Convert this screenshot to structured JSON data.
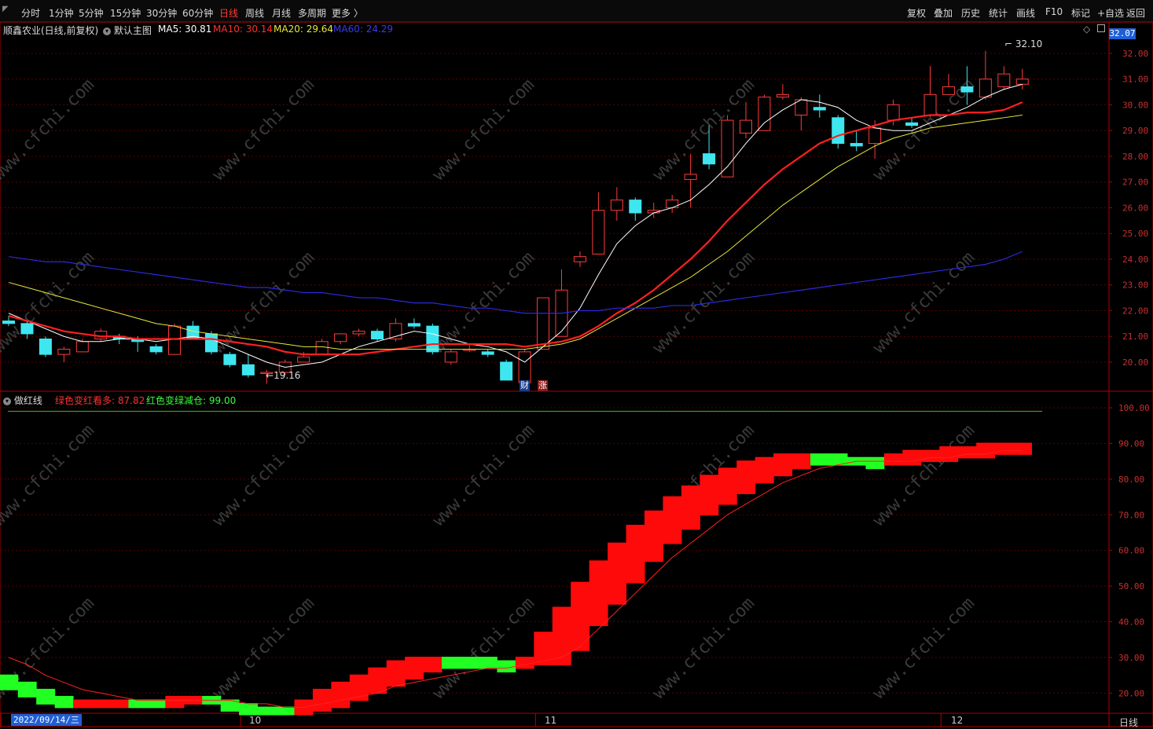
{
  "toolbar": {
    "left": [
      "分时",
      "1分钟",
      "5分钟",
      "15分钟",
      "30分钟",
      "60分钟",
      "日线",
      "周线",
      "月线",
      "多周期",
      "更多 〉"
    ],
    "active": "日线",
    "right": [
      "复权",
      "叠加",
      "历史",
      "统计",
      "画线",
      "F10",
      "标记",
      "+自选",
      "返回"
    ]
  },
  "header": {
    "stock": "顺鑫农业(日线,前复权)",
    "main_label": "默认主图",
    "ma5": "MA5: 30.81",
    "ma10": "MA10: 30.14",
    "ma20": "MA20: 29.64",
    "ma60": "MA60: 24.29",
    "current_price_tag": "32.07"
  },
  "indicator_header": {
    "name": "做红线",
    "green_to_red": "绿色变红看多: 87.82",
    "red_to_green": "红色变绿减仓: 99.00"
  },
  "annotations": {
    "high": "32.10",
    "low": "19.16",
    "badge_cai": "财",
    "badge_zhang": "涨"
  },
  "x_axis": {
    "date_tag": "2022/09/14/三",
    "months": [
      "10",
      "11",
      "12"
    ],
    "period": "日线"
  },
  "colors": {
    "up": "#ff3b3b",
    "down": "#3ee6f0",
    "ma5": "#ffffff",
    "ma10": "#ff2020",
    "ma20": "#e8e83a",
    "ma60": "#2a2adf",
    "grid": "#5a0000",
    "axis": "#b00000",
    "watermark": "#3a3a3a"
  },
  "watermark": "www.cfchi.com",
  "chart_data": [
    {
      "type": "candlestick",
      "title": "顺鑫农业(日线,前复权)",
      "y_ticks": [
        20,
        21,
        22,
        23,
        24,
        25,
        26,
        27,
        28,
        29,
        30,
        31,
        32
      ],
      "ylim": [
        18.9,
        32.7
      ],
      "candles": [
        {
          "o": 21.6,
          "c": 21.5,
          "h": 21.8,
          "l": 21.4
        },
        {
          "o": 21.5,
          "c": 21.1,
          "h": 21.6,
          "l": 20.9
        },
        {
          "o": 20.9,
          "c": 20.3,
          "h": 21.0,
          "l": 20.2
        },
        {
          "o": 20.3,
          "c": 20.5,
          "h": 20.6,
          "l": 20.0
        },
        {
          "o": 20.4,
          "c": 20.8,
          "h": 20.9,
          "l": 20.4
        },
        {
          "o": 20.9,
          "c": 21.2,
          "h": 21.3,
          "l": 20.8
        },
        {
          "o": 21.0,
          "c": 20.9,
          "h": 21.1,
          "l": 20.7
        },
        {
          "o": 20.9,
          "c": 20.8,
          "h": 21.0,
          "l": 20.4
        },
        {
          "o": 20.6,
          "c": 20.4,
          "h": 20.7,
          "l": 20.3
        },
        {
          "o": 20.3,
          "c": 21.4,
          "h": 21.5,
          "l": 20.3
        },
        {
          "o": 21.4,
          "c": 20.9,
          "h": 21.6,
          "l": 20.9
        },
        {
          "o": 21.1,
          "c": 20.4,
          "h": 21.2,
          "l": 20.3
        },
        {
          "o": 20.3,
          "c": 19.9,
          "h": 20.4,
          "l": 19.8
        },
        {
          "o": 19.9,
          "c": 19.5,
          "h": 20.3,
          "l": 19.4
        },
        {
          "o": 19.6,
          "c": 19.6,
          "h": 19.7,
          "l": 19.16
        },
        {
          "o": 19.6,
          "c": 20.0,
          "h": 20.1,
          "l": 19.5
        },
        {
          "o": 20.0,
          "c": 20.2,
          "h": 20.4,
          "l": 20.0
        },
        {
          "o": 20.3,
          "c": 20.8,
          "h": 20.9,
          "l": 20.3
        },
        {
          "o": 20.8,
          "c": 21.1,
          "h": 21.1,
          "l": 20.7
        },
        {
          "o": 21.1,
          "c": 21.2,
          "h": 21.3,
          "l": 21.0
        },
        {
          "o": 21.2,
          "c": 20.9,
          "h": 21.3,
          "l": 20.8
        },
        {
          "o": 20.9,
          "c": 21.5,
          "h": 21.7,
          "l": 20.8
        },
        {
          "o": 21.5,
          "c": 21.4,
          "h": 21.7,
          "l": 21.3
        },
        {
          "o": 21.4,
          "c": 20.4,
          "h": 21.5,
          "l": 20.3
        },
        {
          "o": 20.0,
          "c": 20.4,
          "h": 20.5,
          "l": 19.9
        },
        {
          "o": 20.5,
          "c": 20.5,
          "h": 20.7,
          "l": 20.4
        },
        {
          "o": 20.4,
          "c": 20.3,
          "h": 20.5,
          "l": 20.2
        },
        {
          "o": 20.0,
          "c": 19.3,
          "h": 20.1,
          "l": 19.3
        },
        {
          "o": 19.2,
          "c": 20.4,
          "h": 20.5,
          "l": 19.0
        },
        {
          "o": 20.5,
          "c": 22.5,
          "h": 22.5,
          "l": 20.5
        },
        {
          "o": 21.0,
          "c": 22.8,
          "h": 23.6,
          "l": 21.0
        },
        {
          "o": 23.9,
          "c": 24.1,
          "h": 24.3,
          "l": 23.7
        },
        {
          "o": 24.2,
          "c": 25.9,
          "h": 26.6,
          "l": 24.2
        },
        {
          "o": 25.9,
          "c": 26.3,
          "h": 26.8,
          "l": 25.5
        },
        {
          "o": 26.3,
          "c": 25.8,
          "h": 26.4,
          "l": 25.5
        },
        {
          "o": 25.8,
          "c": 25.9,
          "h": 26.2,
          "l": 25.6
        },
        {
          "o": 26.0,
          "c": 26.3,
          "h": 26.5,
          "l": 25.8
        },
        {
          "o": 27.1,
          "c": 27.3,
          "h": 28.1,
          "l": 26.0
        },
        {
          "o": 28.1,
          "c": 27.7,
          "h": 29.2,
          "l": 27.5
        },
        {
          "o": 27.2,
          "c": 29.4,
          "h": 29.6,
          "l": 27.2
        },
        {
          "o": 28.9,
          "c": 29.4,
          "h": 30.1,
          "l": 28.7
        },
        {
          "o": 29.0,
          "c": 30.3,
          "h": 30.4,
          "l": 29.0
        },
        {
          "o": 30.3,
          "c": 30.4,
          "h": 30.8,
          "l": 30.2
        },
        {
          "o": 29.6,
          "c": 30.2,
          "h": 30.3,
          "l": 29.0
        },
        {
          "o": 29.9,
          "c": 29.8,
          "h": 30.4,
          "l": 29.5
        },
        {
          "o": 29.5,
          "c": 28.5,
          "h": 29.6,
          "l": 28.3
        },
        {
          "o": 28.5,
          "c": 28.4,
          "h": 29.0,
          "l": 28.2
        },
        {
          "o": 28.5,
          "c": 29.1,
          "h": 29.4,
          "l": 27.9
        },
        {
          "o": 29.4,
          "c": 30.0,
          "h": 30.2,
          "l": 29.2
        },
        {
          "o": 29.3,
          "c": 29.2,
          "h": 29.5,
          "l": 29.1
        },
        {
          "o": 29.6,
          "c": 30.4,
          "h": 31.5,
          "l": 29.5
        },
        {
          "o": 30.4,
          "c": 30.7,
          "h": 31.2,
          "l": 30.4
        },
        {
          "o": 30.7,
          "c": 30.5,
          "h": 31.5,
          "l": 30.0
        },
        {
          "o": 30.3,
          "c": 31.0,
          "h": 32.1,
          "l": 30.2
        },
        {
          "o": 30.7,
          "c": 31.2,
          "h": 31.5,
          "l": 30.6
        },
        {
          "o": 30.8,
          "c": 31.0,
          "h": 31.4,
          "l": 30.6
        }
      ],
      "series": [
        {
          "name": "MA5",
          "values": [
            21.9,
            21.6,
            21.3,
            21.0,
            20.8,
            20.8,
            20.9,
            20.9,
            20.8,
            20.9,
            21.0,
            20.9,
            20.6,
            20.3,
            20.0,
            19.8,
            19.9,
            20.0,
            20.3,
            20.6,
            20.8,
            21.0,
            21.2,
            21.1,
            20.9,
            20.7,
            20.6,
            20.4,
            20.0,
            20.6,
            21.2,
            22.1,
            23.4,
            24.6,
            25.3,
            25.8,
            26.0,
            26.3,
            26.9,
            27.6,
            28.5,
            29.3,
            29.8,
            30.2,
            30.1,
            29.9,
            29.4,
            29.1,
            29.0,
            29.0,
            29.3,
            29.6,
            29.9,
            30.3,
            30.6,
            30.8
          ]
        },
        {
          "name": "MA10",
          "values": [
            21.8,
            21.6,
            21.4,
            21.2,
            21.1,
            21.0,
            21.0,
            20.9,
            20.9,
            20.9,
            20.9,
            20.9,
            20.8,
            20.7,
            20.6,
            20.4,
            20.3,
            20.3,
            20.3,
            20.3,
            20.4,
            20.5,
            20.6,
            20.7,
            20.7,
            20.7,
            20.7,
            20.7,
            20.6,
            20.7,
            20.8,
            21.0,
            21.4,
            21.9,
            22.3,
            22.8,
            23.4,
            24.0,
            24.7,
            25.5,
            26.2,
            26.9,
            27.5,
            28.0,
            28.5,
            28.8,
            29.0,
            29.2,
            29.4,
            29.5,
            29.6,
            29.6,
            29.7,
            29.7,
            29.8,
            30.1
          ]
        },
        {
          "name": "MA20",
          "values": [
            23.1,
            22.9,
            22.7,
            22.5,
            22.3,
            22.1,
            21.9,
            21.7,
            21.5,
            21.4,
            21.2,
            21.1,
            21.0,
            20.9,
            20.8,
            20.7,
            20.6,
            20.6,
            20.5,
            20.5,
            20.5,
            20.5,
            20.5,
            20.5,
            20.5,
            20.5,
            20.5,
            20.5,
            20.5,
            20.6,
            20.7,
            20.9,
            21.3,
            21.7,
            22.1,
            22.5,
            22.9,
            23.3,
            23.8,
            24.3,
            24.9,
            25.5,
            26.1,
            26.6,
            27.1,
            27.6,
            28.0,
            28.4,
            28.7,
            28.9,
            29.1,
            29.2,
            29.3,
            29.4,
            29.5,
            29.6
          ]
        },
        {
          "name": "MA60",
          "values": [
            24.1,
            24.0,
            23.9,
            23.9,
            23.8,
            23.7,
            23.6,
            23.5,
            23.4,
            23.3,
            23.2,
            23.1,
            23.0,
            22.9,
            22.9,
            22.8,
            22.7,
            22.7,
            22.6,
            22.5,
            22.5,
            22.4,
            22.3,
            22.3,
            22.2,
            22.1,
            22.1,
            22.0,
            21.9,
            21.9,
            21.9,
            22.0,
            22.0,
            22.1,
            22.1,
            22.1,
            22.2,
            22.2,
            22.3,
            22.4,
            22.5,
            22.6,
            22.7,
            22.8,
            22.9,
            23.0,
            23.1,
            23.2,
            23.3,
            23.4,
            23.5,
            23.6,
            23.7,
            23.8,
            24.0,
            24.3
          ]
        }
      ]
    },
    {
      "type": "step-band",
      "title": "做红线",
      "y_ticks": [
        20,
        30,
        40,
        50,
        60,
        70,
        80,
        90,
        100
      ],
      "ylim": [
        15,
        102
      ],
      "line_value": 99.0,
      "band": [
        {
          "a": 24,
          "b": 22,
          "up": false
        },
        {
          "a": 22,
          "b": 20,
          "up": false
        },
        {
          "a": 20,
          "b": 18,
          "up": false
        },
        {
          "a": 18,
          "b": 17,
          "up": false
        },
        {
          "a": 17,
          "b": 17,
          "up": true
        },
        {
          "a": 17,
          "b": 17,
          "up": true
        },
        {
          "a": 17,
          "b": 17,
          "up": true
        },
        {
          "a": 17,
          "b": 17,
          "up": false
        },
        {
          "a": 17,
          "b": 17,
          "up": false
        },
        {
          "a": 17,
          "b": 18,
          "up": true
        },
        {
          "a": 18,
          "b": 18,
          "up": true
        },
        {
          "a": 18,
          "b": 18,
          "up": false
        },
        {
          "a": 17,
          "b": 16,
          "up": false
        },
        {
          "a": 16,
          "b": 15,
          "up": false
        },
        {
          "a": 15,
          "b": 15,
          "up": false
        },
        {
          "a": 15,
          "b": 15,
          "up": false
        },
        {
          "a": 15,
          "b": 17,
          "up": true
        },
        {
          "a": 16,
          "b": 20,
          "up": true
        },
        {
          "a": 17,
          "b": 22,
          "up": true
        },
        {
          "a": 19,
          "b": 24,
          "up": true
        },
        {
          "a": 21,
          "b": 26,
          "up": true
        },
        {
          "a": 23,
          "b": 28,
          "up": true
        },
        {
          "a": 25,
          "b": 29,
          "up": true
        },
        {
          "a": 27,
          "b": 29,
          "up": true
        },
        {
          "a": 28,
          "b": 29,
          "up": false
        },
        {
          "a": 28,
          "b": 29,
          "up": false
        },
        {
          "a": 28,
          "b": 29,
          "up": false
        },
        {
          "a": 27,
          "b": 28,
          "up": false
        },
        {
          "a": 28,
          "b": 29,
          "up": true
        },
        {
          "a": 29,
          "b": 36,
          "up": true
        },
        {
          "a": 29,
          "b": 43,
          "up": true
        },
        {
          "a": 33,
          "b": 50,
          "up": true
        },
        {
          "a": 40,
          "b": 56,
          "up": true
        },
        {
          "a": 46,
          "b": 61,
          "up": true
        },
        {
          "a": 52,
          "b": 66,
          "up": true
        },
        {
          "a": 58,
          "b": 70,
          "up": true
        },
        {
          "a": 63,
          "b": 74,
          "up": true
        },
        {
          "a": 67,
          "b": 77,
          "up": true
        },
        {
          "a": 71,
          "b": 80,
          "up": true
        },
        {
          "a": 74,
          "b": 82,
          "up": true
        },
        {
          "a": 77,
          "b": 84,
          "up": true
        },
        {
          "a": 80,
          "b": 85,
          "up": true
        },
        {
          "a": 82,
          "b": 86,
          "up": true
        },
        {
          "a": 84,
          "b": 86,
          "up": true
        },
        {
          "a": 85,
          "b": 86,
          "up": false
        },
        {
          "a": 85,
          "b": 86,
          "up": false
        },
        {
          "a": 85,
          "b": 85,
          "up": false
        },
        {
          "a": 84,
          "b": 85,
          "up": false
        },
        {
          "a": 85,
          "b": 86,
          "up": true
        },
        {
          "a": 85,
          "b": 87,
          "up": true
        },
        {
          "a": 86,
          "b": 87,
          "up": true
        },
        {
          "a": 86,
          "b": 88,
          "up": true
        },
        {
          "a": 87,
          "b": 88,
          "up": true
        },
        {
          "a": 87,
          "b": 89,
          "up": true
        },
        {
          "a": 88,
          "b": 89,
          "up": true
        },
        {
          "a": 88,
          "b": 89,
          "up": true
        }
      ],
      "line": [
        30,
        28,
        25,
        23,
        21,
        20,
        19,
        18,
        18,
        18,
        18,
        18,
        18,
        17,
        17,
        16,
        16,
        17,
        18,
        19,
        20,
        22,
        23,
        24,
        25,
        26,
        27,
        27,
        28,
        29,
        30,
        33,
        38,
        43,
        48,
        53,
        58,
        62,
        66,
        70,
        73,
        76,
        79,
        81,
        83,
        84,
        85,
        85,
        85,
        85,
        86,
        86,
        87,
        87,
        88,
        88
      ]
    }
  ]
}
